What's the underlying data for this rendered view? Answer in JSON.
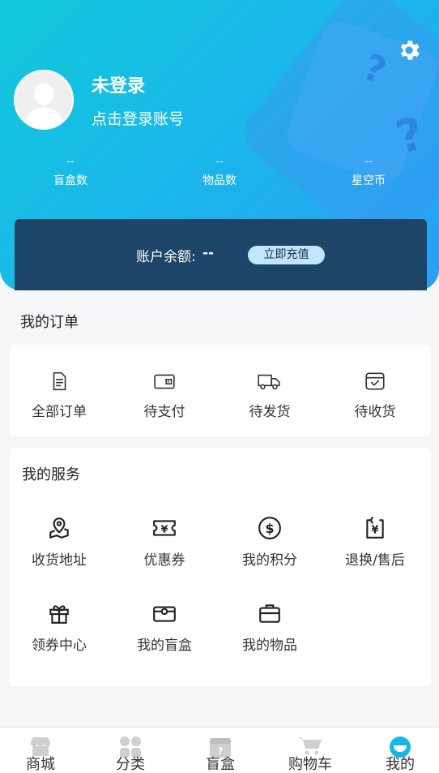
{
  "profile": {
    "username": "未登录",
    "login_hint": "点击登录账号"
  },
  "stats": [
    {
      "value": "--",
      "label": "盲盒数"
    },
    {
      "value": "--",
      "label": "物品数"
    },
    {
      "value": "--",
      "label": "星空币"
    }
  ],
  "balance": {
    "label": "账户余额:",
    "value": "--",
    "recharge_label": "立即充值"
  },
  "orders": {
    "title": "我的订单",
    "items": [
      {
        "label": "全部订单",
        "icon": "order-list-icon"
      },
      {
        "label": "待支付",
        "icon": "wallet-icon"
      },
      {
        "label": "待发货",
        "icon": "truck-icon"
      },
      {
        "label": "待收货",
        "icon": "box-check-icon"
      }
    ]
  },
  "services": {
    "title": "我的服务",
    "items": [
      {
        "label": "收货地址",
        "icon": "map-pin-icon"
      },
      {
        "label": "优惠券",
        "icon": "coupon-icon"
      },
      {
        "label": "我的积分",
        "icon": "dollar-circle-icon"
      },
      {
        "label": "退换/售后",
        "icon": "refund-icon"
      },
      {
        "label": "领券中心",
        "icon": "gift-icon"
      },
      {
        "label": "我的盲盒",
        "icon": "blind-box-icon"
      },
      {
        "label": "我的物品",
        "icon": "bag-icon"
      }
    ]
  },
  "tabbar": [
    {
      "label": "商城",
      "icon": "store-icon"
    },
    {
      "label": "分类",
      "icon": "category-icon"
    },
    {
      "label": "盲盒",
      "icon": "mystery-box-icon"
    },
    {
      "label": "购物车",
      "icon": "cart-icon"
    },
    {
      "label": "我的",
      "icon": "profile-icon"
    }
  ],
  "colors": {
    "header_start": "#12c9d9",
    "header_end": "#2a9ff6",
    "balance_card": "#1d4568",
    "recharge_button": "#bfe6fa"
  }
}
